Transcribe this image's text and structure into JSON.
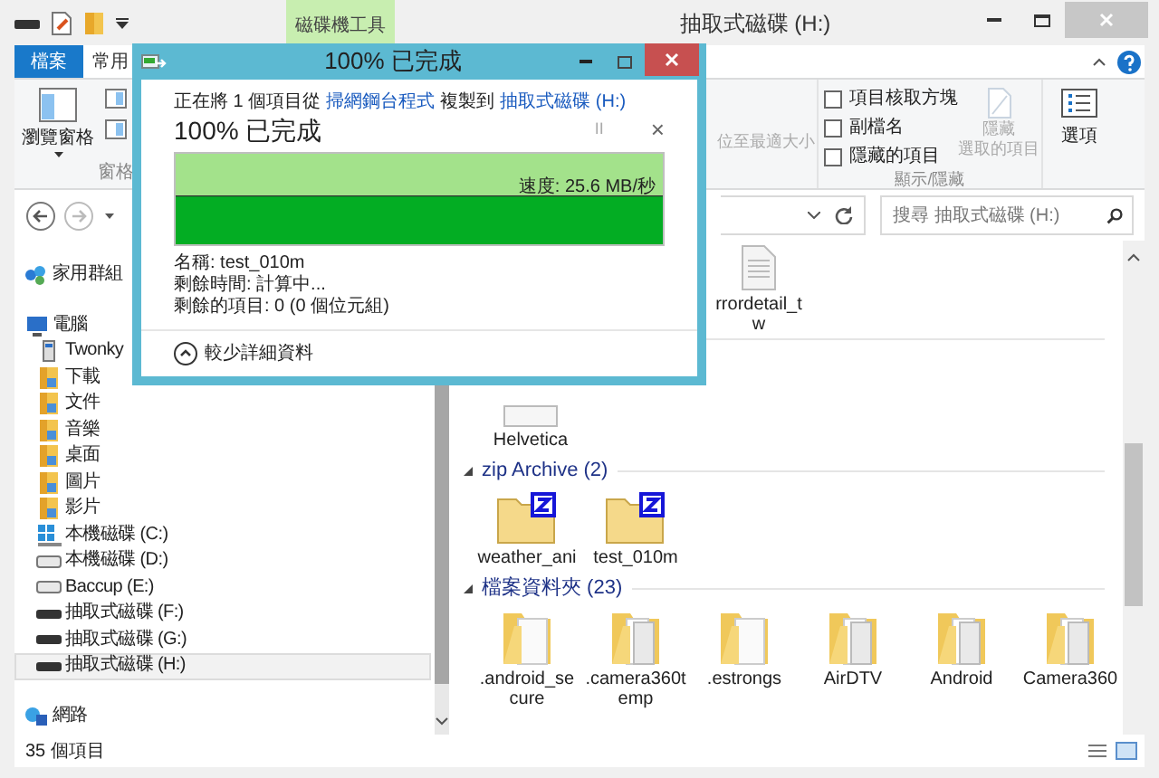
{
  "explorer": {
    "title": "抽取式磁碟 (H:)",
    "context_tab": "磁碟機工具",
    "tabs": [
      {
        "label": "檔案",
        "kind": "file"
      },
      {
        "label": "常用",
        "kind": "normal"
      }
    ],
    "ribbon": {
      "pane_button": "瀏覽窗格",
      "pane_group": "窗格",
      "cut_label": "位至最適大小",
      "checkboxes": [
        {
          "label": "項目核取方塊",
          "checked": false
        },
        {
          "label": "副檔名",
          "checked": false
        },
        {
          "label": "隱藏的項目",
          "checked": false
        }
      ],
      "hide_button": [
        "隱藏",
        "選取的項目"
      ],
      "show_group": "顯示/隱藏",
      "options_button": "選項"
    },
    "search": {
      "placeholder": "搜尋 抽取式磁碟 (H:)"
    },
    "tree": [
      {
        "label": "家用群組",
        "kind": "homegroup",
        "selected": false
      },
      {
        "label": "電腦",
        "kind": "computer",
        "selected": false,
        "children": [
          {
            "label": "Twonky",
            "kind": "media",
            "selected": false
          },
          {
            "label": "下載",
            "kind": "folder",
            "selected": false
          },
          {
            "label": "文件",
            "kind": "folder",
            "selected": false
          },
          {
            "label": "音樂",
            "kind": "folder",
            "selected": false
          },
          {
            "label": "桌面",
            "kind": "folder",
            "selected": false
          },
          {
            "label": "圖片",
            "kind": "folder",
            "selected": false
          },
          {
            "label": "影片",
            "kind": "folder",
            "selected": false
          },
          {
            "label": "本機磁碟 (C:)",
            "kind": "system",
            "selected": false
          },
          {
            "label": "本機磁碟 (D:)",
            "kind": "drive",
            "selected": false
          },
          {
            "label": "Baccup (E:)",
            "kind": "drive",
            "selected": false
          },
          {
            "label": "抽取式磁碟 (F:)",
            "kind": "removable",
            "selected": false
          },
          {
            "label": "抽取式磁碟 (G:)",
            "kind": "removable",
            "selected": false
          },
          {
            "label": "抽取式磁碟 (H:)",
            "kind": "removable",
            "selected": true
          }
        ]
      },
      {
        "label": "網路",
        "kind": "network",
        "selected": false
      }
    ],
    "top_items": [
      {
        "name": "rrordetail_tw",
        "kind": "document"
      },
      {
        "name": "Helvetica",
        "kind": "font"
      }
    ],
    "groups": [
      {
        "title": "zip Archive (2)",
        "items": [
          {
            "name": "weather_ani",
            "kind": "zip"
          },
          {
            "name": "test_010m",
            "kind": "zip"
          }
        ]
      },
      {
        "title": "檔案資料夾 (23)",
        "items": [
          {
            "name": ".android_secure",
            "kind": "plain"
          },
          {
            "name": ".camera360temp",
            "kind": "folder"
          },
          {
            "name": ".estrongs",
            "kind": "plain"
          },
          {
            "name": "AirDTV",
            "kind": "folder"
          },
          {
            "name": "Android",
            "kind": "folder"
          },
          {
            "name": "Camera360",
            "kind": "folder"
          }
        ]
      }
    ],
    "status": "35 個項目"
  },
  "dialog": {
    "title": "100% 已完成",
    "copy_prefix": "正在將 1 個項目從",
    "source": "掃網鋼台程式",
    "copy_middle": "複製到",
    "destination": "抽取式磁碟 (H:)",
    "heading": "100% 已完成",
    "pause": "II",
    "cancel": "×",
    "progress": {
      "level": 1.0
    },
    "speed": "速度: 25.6 MB/秒",
    "details": [
      "名稱: test_010m",
      "剩餘時間: 計算中...",
      "剩餘的項目: 0 (0 個位元組)"
    ],
    "less_details": "較少詳細資料"
  }
}
